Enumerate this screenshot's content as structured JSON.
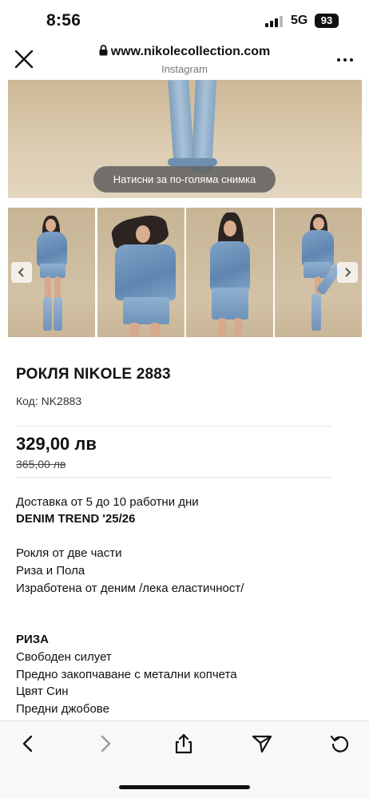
{
  "status_bar": {
    "time": "8:56",
    "network": "5G",
    "battery": "93"
  },
  "browser": {
    "url": "www.nikolecollection.com",
    "source": "Instagram",
    "icons": {
      "close": "close-icon",
      "lock": "lock-icon",
      "more": "more-icon"
    }
  },
  "gallery": {
    "hint": "Натисни за по-голяма снимка",
    "thumbnail_count": 4
  },
  "product": {
    "title": "РОКЛЯ NIKOLE 2883",
    "sku": "Код: NK2883",
    "price": "329,00 лв",
    "old_price": "365,00 лв"
  },
  "description": {
    "lines": [
      "Доставка от 5 до 10 работни дни",
      "DENIM TREND '25/26",
      "Рокля от две части",
      "Риза и Пола",
      "Изработена от деним /лека еластичност/",
      "РИЗА",
      "Свободен силует",
      "Предно закопчаване с метални копчета",
      "Цвят Син",
      "Предни джобове"
    ]
  },
  "toolbar": {
    "icons": [
      "back-icon",
      "forward-icon",
      "share-icon",
      "send-icon",
      "reload-icon"
    ]
  },
  "colors": {
    "accent_text": "#111111",
    "muted": "#777777",
    "pill_bg": "#5a5a5a",
    "toolbar_bg": "#f8f8f8"
  }
}
